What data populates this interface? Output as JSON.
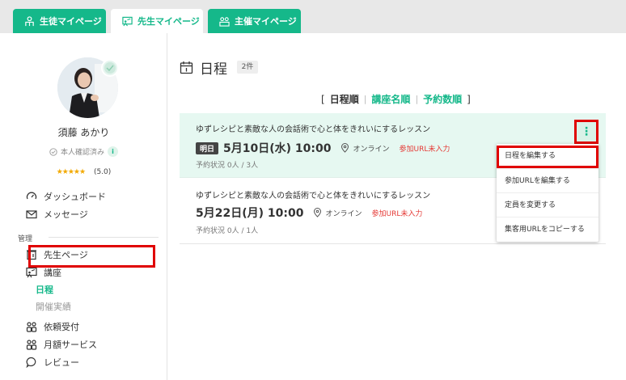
{
  "tabs": [
    {
      "label": "生徒マイページ",
      "icon": "student-icon"
    },
    {
      "label": "先生マイページ",
      "icon": "teacher-icon"
    },
    {
      "label": "主催マイページ",
      "icon": "organizer-icon"
    }
  ],
  "profile": {
    "name": "須藤 あかり",
    "verified": "本人確認済み",
    "info": "i",
    "stars": "★★★★★",
    "rating": "(5.0)"
  },
  "sidebar": {
    "dashboard": "ダッシュボード",
    "messages": "メッセージ",
    "section": "管理",
    "teacher_page": "先生ページ",
    "course": "講座",
    "schedule": "日程",
    "history": "開催実績",
    "requests": "依頼受付",
    "monthly": "月額サービス",
    "review": "レビュー"
  },
  "main": {
    "title": "日程",
    "count": "2件",
    "sort": {
      "open": "[",
      "date": "日程順",
      "course": "講座名順",
      "booking": "予約数順",
      "close": "]"
    }
  },
  "cards": [
    {
      "title": "ゆずレシピと素敵な人の会話術で心と体をきれいにするレッスン",
      "badge": "明日",
      "date": "5月10日(水) 10:00",
      "location": "オンライン",
      "warning": "参加URL未入力",
      "status_label": "予約状況",
      "status_value": "0人 / 3人"
    },
    {
      "title": "ゆずレシピと素敵な人の会話術で心と体をきれいにするレッスン",
      "date": "5月22日(月) 10:00",
      "location": "オンライン",
      "warning": "参加URL未入力",
      "status_label": "予約状況",
      "status_value": "0人 / 1人"
    }
  ],
  "menu": {
    "kebab": "⋮",
    "edit_schedule": "日程を編集する",
    "edit_url": "参加URLを編集する",
    "change_capacity": "定員を変更する",
    "copy_url": "集客用URLをコピーする"
  }
}
